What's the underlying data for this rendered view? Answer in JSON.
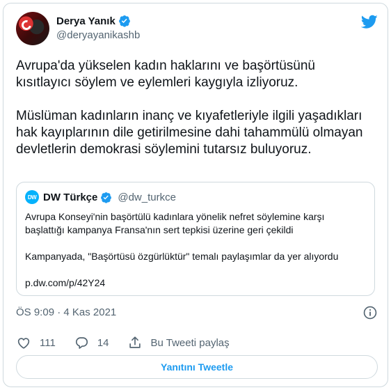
{
  "author": {
    "display_name": "Derya Yanık",
    "handle": "@deryayanikashb",
    "verified": true
  },
  "tweet": {
    "text": "Avrupa'da yükselen kadın haklarını ve başörtüsünü kısıtlayıcı söylem ve eylemleri kaygıyla izliyoruz.\n\nMüslüman kadınların inanç ve kıyafetleriyle ilgili yaşadıkları hak kayıplarının dile getirilmesine dahi tahammülü olmayan devletlerin demokrasi söylemini tutarsız buluyoruz."
  },
  "quote": {
    "avatar_text": "DW",
    "display_name": "DW Türkçe",
    "handle": "@dw_turkce",
    "verified": true,
    "text": "Avrupa Konseyi'nin başörtülü kadınlara yönelik nefret söylemine karşı başlattığı kampanya Fransa'nın sert tepkisi üzerine geri çekildi\n\nKampanyada, \"Başörtüsü özgürlüktür\" temalı paylaşımlar da yer alıyordu\n\np.dw.com/p/42Y24"
  },
  "meta": {
    "timestamp": "ÖS 9:09 · 4 Kas 2021"
  },
  "actions": {
    "likes": "111",
    "replies": "14",
    "share_label": "Bu Tweeti paylaş"
  },
  "reply_button": {
    "label": "Yanıtını Tweetle"
  },
  "colors": {
    "accent": "#1d9bf0",
    "text": "#0f1419",
    "secondary": "#536471",
    "border": "#cfd9de"
  },
  "icons": [
    "twitter-bird-icon",
    "verified-badge-icon",
    "info-icon",
    "heart-icon",
    "reply-icon",
    "share-icon"
  ]
}
